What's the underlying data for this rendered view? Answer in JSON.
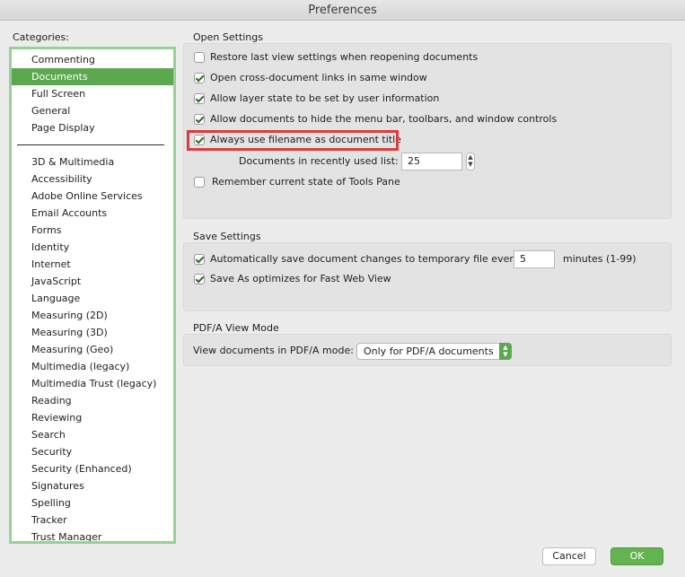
{
  "window": {
    "title": "Preferences"
  },
  "categories": {
    "label": "Categories:",
    "items": [
      "Commenting",
      "Documents",
      "Full Screen",
      "General",
      "Page Display",
      "3D & Multimedia",
      "Accessibility",
      "Adobe Online Services",
      "Email Accounts",
      "Forms",
      "Identity",
      "Internet",
      "JavaScript",
      "Language",
      "Measuring (2D)",
      "Measuring (3D)",
      "Measuring (Geo)",
      "Multimedia (legacy)",
      "Multimedia Trust (legacy)",
      "Reading",
      "Reviewing",
      "Search",
      "Security",
      "Security (Enhanced)",
      "Signatures",
      "Spelling",
      "Tracker",
      "Trust Manager"
    ],
    "selected": "Documents"
  },
  "open_settings": {
    "title": "Open Settings",
    "restore_last_view": {
      "label": "Restore last view settings when reopening documents",
      "checked": false
    },
    "open_cross_doc_links": {
      "label": "Open cross-document links in same window",
      "checked": true
    },
    "allow_layer_state": {
      "label": "Allow layer state to be set by user information",
      "checked": true
    },
    "allow_hide_menu": {
      "label": "Allow documents to hide the menu bar, toolbars, and window controls",
      "checked": true
    },
    "always_use_filename": {
      "label": "Always use filename as document title",
      "checked": true
    },
    "recent_list_label": "Documents in recently used list:",
    "recent_list_value": "25",
    "remember_tools_pane": {
      "label": "Remember current state of Tools Pane",
      "checked": false
    }
  },
  "save_settings": {
    "title": "Save Settings",
    "auto_save": {
      "label": "Automatically save document changes to temporary file every:",
      "checked": true
    },
    "auto_save_minutes": "5",
    "minutes_label": "minutes (1-99)",
    "fast_web_view": {
      "label": "Save As optimizes for Fast Web View",
      "checked": true
    }
  },
  "pdfa": {
    "title": "PDF/A View Mode",
    "label": "View documents in PDF/A mode:",
    "selected": "Only for PDF/A documents"
  },
  "buttons": {
    "cancel": "Cancel",
    "ok": "OK"
  },
  "colors": {
    "accent": "#5ba84f",
    "highlight": "#e03b3b"
  }
}
